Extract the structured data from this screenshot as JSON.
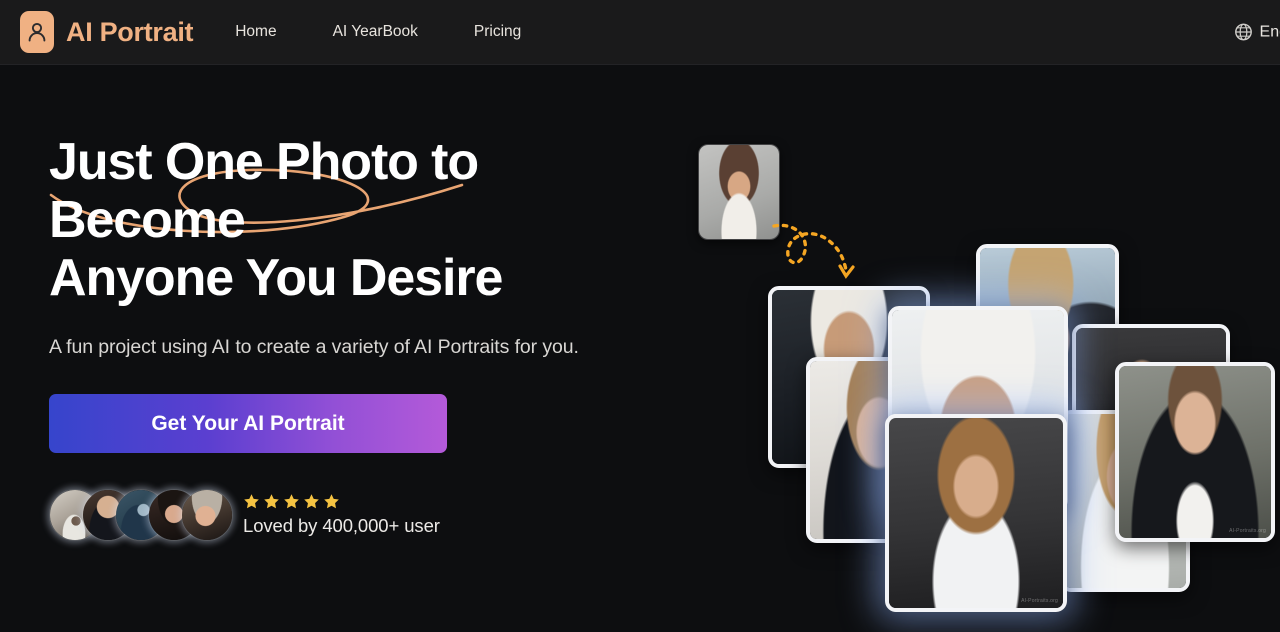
{
  "header": {
    "logo_icon": "user-portrait-icon",
    "brand_name": "AI Portrait",
    "nav": [
      {
        "label": "Home",
        "name": "nav-home"
      },
      {
        "label": "AI YearBook",
        "name": "nav-ai-yearbook"
      },
      {
        "label": "Pricing",
        "name": "nav-pricing"
      }
    ],
    "language": {
      "icon": "globe-icon",
      "label": "Eng"
    },
    "colors": {
      "brand": "#f0b183",
      "bar_bg": "#1a1a1b"
    }
  },
  "hero": {
    "headline_line1": "Just One Photo to Become",
    "headline_line2": "Anyone You Desire",
    "headline_accent_color": "#e8a472",
    "subtitle": "A fun project using AI to create a variety of AI Portraits for you.",
    "cta_label": "Get Your AI Portrait",
    "cta_gradient_from": "#3645cc",
    "cta_gradient_to": "#b45ad9"
  },
  "social_proof": {
    "stars": 5,
    "star_color": "#f5c342",
    "loved_text": "Loved by 400,000+ user",
    "avatars": [
      {
        "name": "avatar-1"
      },
      {
        "name": "avatar-2"
      },
      {
        "name": "avatar-3"
      },
      {
        "name": "avatar-4"
      },
      {
        "name": "avatar-5"
      }
    ]
  },
  "collage": {
    "source_photo_label": "source-portrait-photo",
    "arrow_label": "dashed-transform-arrow",
    "arrow_color": "#f5a623",
    "watermark": "AI-Portraits.org",
    "cards": [
      {
        "name": "portrait-card-captain"
      },
      {
        "name": "portrait-card-jacket"
      },
      {
        "name": "portrait-card-police"
      },
      {
        "name": "portrait-card-astronaut"
      },
      {
        "name": "portrait-card-longhair"
      },
      {
        "name": "portrait-card-suit"
      },
      {
        "name": "portrait-card-glasses-doctor"
      },
      {
        "name": "portrait-card-doctor"
      }
    ]
  }
}
